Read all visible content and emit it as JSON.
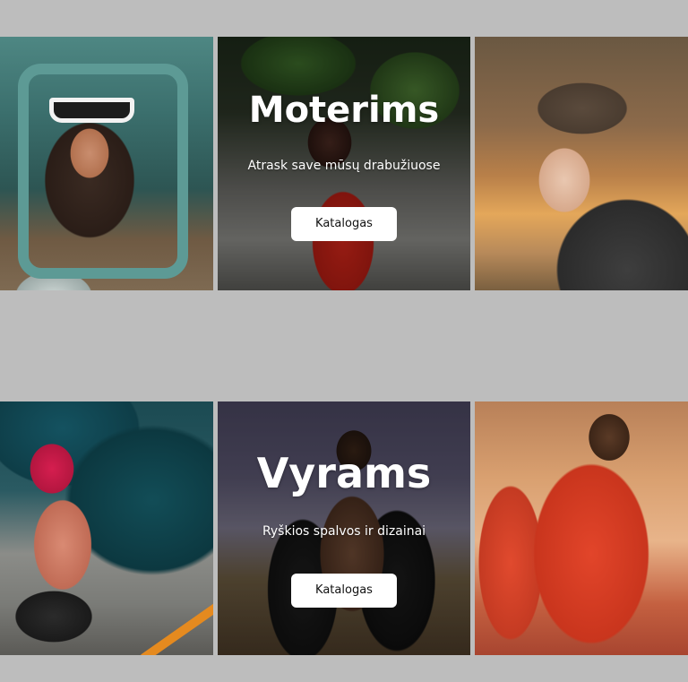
{
  "sections": [
    {
      "heading": "Moterims",
      "subtitle": "Atrask save mūsų drabužiuose",
      "button_label": "Katalogas"
    },
    {
      "heading": "Vyrams",
      "subtitle": "Ryškios spalvos ir dizainai",
      "button_label": "Katalogas"
    }
  ],
  "colors": {
    "page_background": "#bdbdbd",
    "button_background": "#ffffff",
    "heading_text": "#ffffff"
  }
}
